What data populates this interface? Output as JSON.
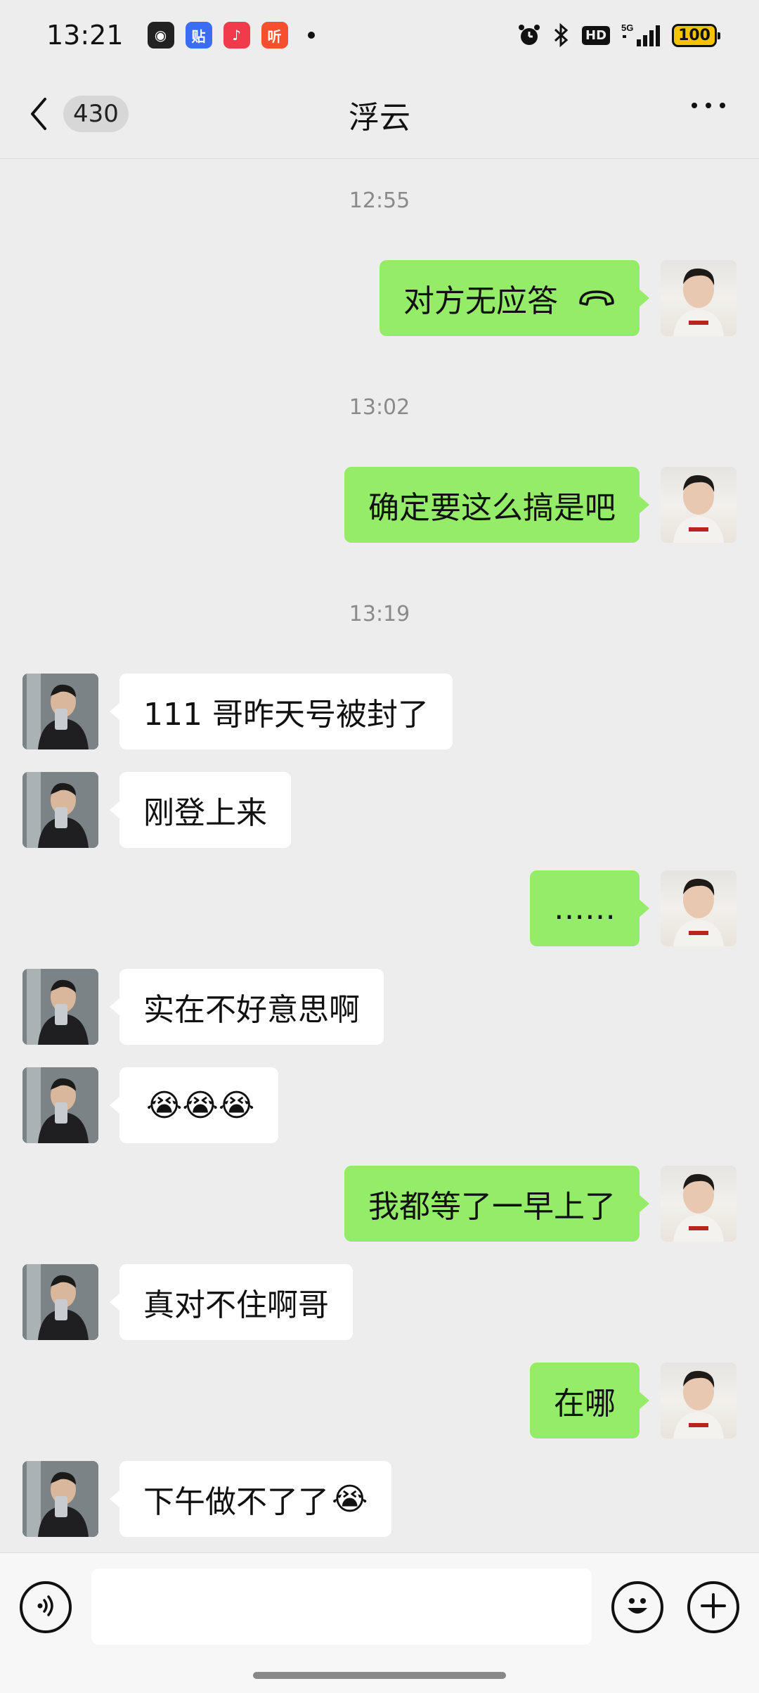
{
  "status_bar": {
    "time": "13:21",
    "app_icons": [
      {
        "name": "game-app-icon",
        "color": "#222222",
        "glyph": "◉"
      },
      {
        "name": "tieba-app-icon",
        "color": "#3a6cf4",
        "glyph": "贴"
      },
      {
        "name": "music-app-icon",
        "color": "#f23a4d",
        "glyph": "♪"
      },
      {
        "name": "listen-app-icon",
        "color": "#f5502d",
        "glyph": "听"
      }
    ],
    "network": "5G",
    "hd": "HD",
    "battery": "100"
  },
  "nav": {
    "unread_count": "430",
    "title": "浮云"
  },
  "messages": [
    {
      "type": "time",
      "text": "12:55"
    },
    {
      "type": "msg",
      "from": "me",
      "text": "对方无应答",
      "call": true
    },
    {
      "type": "time",
      "text": "13:02"
    },
    {
      "type": "msg",
      "from": "me",
      "text": "确定要这么搞是吧"
    },
    {
      "type": "time",
      "text": "13:19"
    },
    {
      "type": "msg",
      "from": "them",
      "text": "111 哥昨天号被封了"
    },
    {
      "type": "msg",
      "from": "them",
      "text": "刚登上来"
    },
    {
      "type": "msg",
      "from": "me",
      "text": "……"
    },
    {
      "type": "msg",
      "from": "them",
      "text": "实在不好意思啊"
    },
    {
      "type": "msg",
      "from": "them",
      "text": "",
      "emoji": "😭😭😭"
    },
    {
      "type": "msg",
      "from": "me",
      "text": "我都等了一早上了"
    },
    {
      "type": "msg",
      "from": "them",
      "text": "真对不住啊哥"
    },
    {
      "type": "msg",
      "from": "me",
      "text": "在哪"
    },
    {
      "type": "msg",
      "from": "them",
      "text": "下午做不了了",
      "emoji": "😭"
    }
  ],
  "input": {
    "value": ""
  },
  "colors": {
    "my_bubble": "#95ec69",
    "their_bubble": "#ffffff",
    "background": "#ededed"
  }
}
